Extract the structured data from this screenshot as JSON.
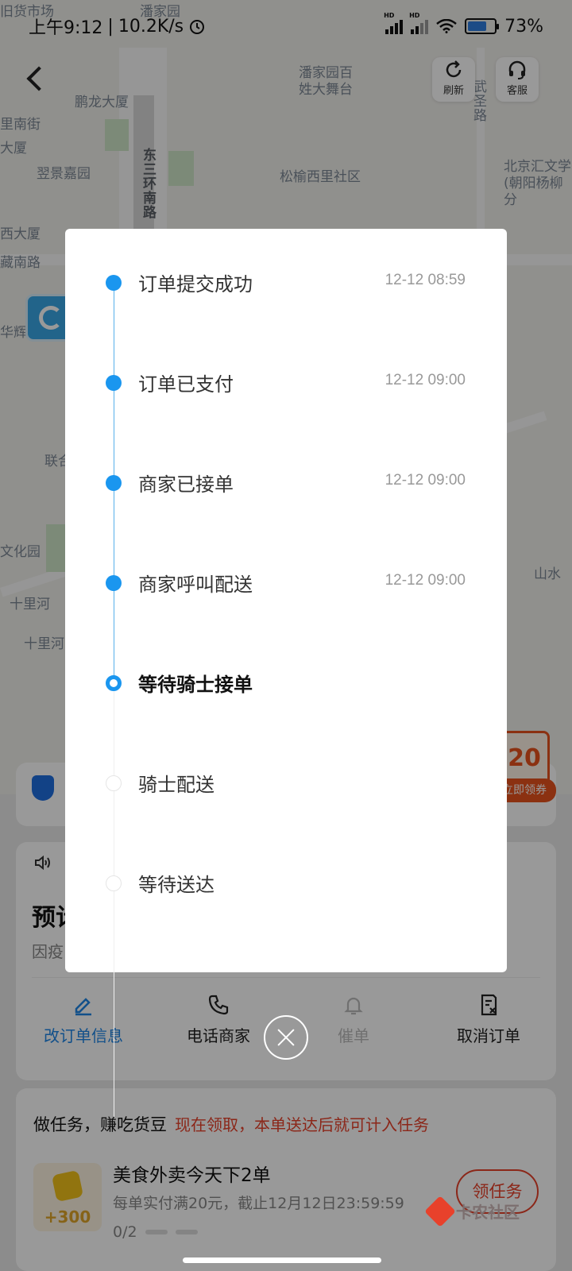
{
  "status_bar": {
    "time": "上午9:12",
    "net_speed": "10.2K/s",
    "battery": "73%",
    "battery_level": 0.73
  },
  "map": {
    "labels": [
      "旧货市场",
      "潘家园",
      "潘家园百姓大舞台",
      "鹏龙大厦",
      "武圣路",
      "里南街",
      "大厦",
      "翌景嘉园",
      "东三环南路",
      "松榆西里社区",
      "北京汇文学(朝阳杨柳分",
      "西大厦",
      "藏南路",
      "华辉",
      "联合",
      "文化园",
      "十里河",
      "十里河",
      "山水"
    ]
  },
  "top_bar": {
    "refresh_label": "刷新",
    "service_label": "客服"
  },
  "timeline": {
    "steps": [
      {
        "label": "订单提交成功",
        "time": "12-12 08:59",
        "state": "done"
      },
      {
        "label": "订单已支付",
        "time": "12-12 09:00",
        "state": "done"
      },
      {
        "label": "商家已接单",
        "time": "12-12 09:00",
        "state": "done"
      },
      {
        "label": "商家呼叫配送",
        "time": "12-12 09:00",
        "state": "done"
      },
      {
        "label": "等待骑士接单",
        "time": "",
        "state": "current"
      },
      {
        "label": "骑士配送",
        "time": "",
        "state": "pending"
      },
      {
        "label": "等待送达",
        "time": "",
        "state": "pending"
      }
    ]
  },
  "coupon": {
    "amount": "20",
    "label": "立即领券"
  },
  "order_card": {
    "title_snippet": "预计",
    "subtitle_snippet": "因疫",
    "actions": [
      {
        "label": "改订单信息",
        "icon": "edit-icon"
      },
      {
        "label": "电话商家",
        "icon": "phone-icon"
      },
      {
        "label": "催单",
        "icon": "bell-icon"
      },
      {
        "label": "取消订单",
        "icon": "cancel-order-icon"
      }
    ]
  },
  "task_card": {
    "title": "做任务，赚吃货豆",
    "promo": "现在领取，本单送达后就可计入任务",
    "points": "+300",
    "task_name": "美食外卖今天下2单",
    "task_desc": "每单实付满20元，截止12月12日23:59:59",
    "progress": "0/2",
    "button_label": "领任务"
  },
  "watermark": "卡农社区",
  "colors": {
    "accent_blue": "#1a96ef",
    "action_blue": "#1e86e6",
    "promo_red": "#e8412b",
    "coupon_orange": "#e8531d"
  }
}
